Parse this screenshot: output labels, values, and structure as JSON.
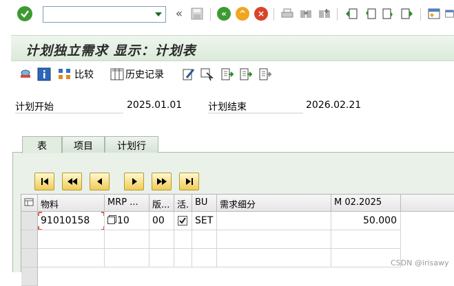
{
  "title": "计划独立需求 显示：计划表",
  "toolbar": {
    "okcode_value": "",
    "icons": [
      "ok-check-icon",
      "back-icon",
      "save-icon",
      "back-green-icon",
      "exit-icon",
      "cancel-icon",
      "print-icon",
      "find-icon",
      "find-next-icon",
      "first-page-icon",
      "prev-page-icon",
      "next-page-icon",
      "last-page-icon",
      "new-session-icon",
      "shortcut-icon"
    ]
  },
  "app_toolbar": {
    "compare_label": "比较",
    "history_label": "历史记录"
  },
  "fields": {
    "plan_start_label": "计划开始",
    "plan_start_value": "2025.01.01",
    "plan_end_label": "计划结束",
    "plan_end_value": "2026.02.21"
  },
  "tabs": [
    {
      "label": "表"
    },
    {
      "label": "项目"
    },
    {
      "label": "计划行"
    }
  ],
  "grid": {
    "headers": [
      "物料",
      "MRP ...",
      "版...",
      "活.",
      "BU",
      "需求细分",
      "M 02.2025"
    ],
    "rows": [
      {
        "material": "91010158",
        "mrp": "10",
        "version": "00",
        "active": true,
        "bu": "SET",
        "segment": "",
        "qty": "50.000"
      }
    ]
  },
  "watermark": "CSDN @irisawy",
  "colors": {
    "title_bg": "#dbead9",
    "tab_pane_bg": "#e9f1e8",
    "nav_button": "#f0cc57"
  }
}
